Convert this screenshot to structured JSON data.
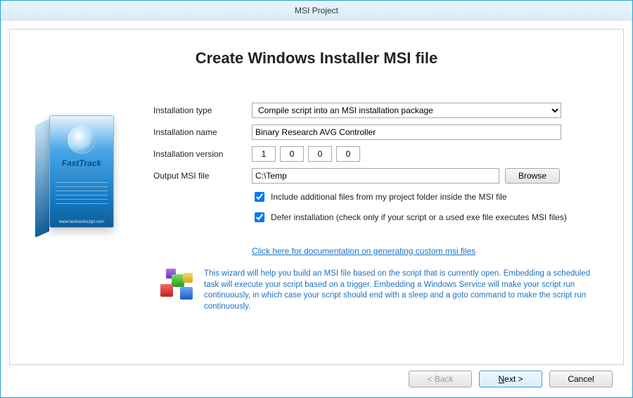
{
  "window": {
    "title": "MSI Project"
  },
  "page": {
    "heading": "Create Windows Installer MSI file"
  },
  "box": {
    "brand": "FastTrack",
    "tag": "ENTERPRISE",
    "footer": "www.fasttrackscript.com"
  },
  "labels": {
    "install_type": "Installation type",
    "install_name": "Installation name",
    "install_version": "Installation version",
    "output_file": "Output MSI file"
  },
  "fields": {
    "install_type_value": "Compile script into an MSI installation package",
    "install_name_value": "Binary Research AVG Controller",
    "version": [
      "1",
      "0",
      "0",
      "0"
    ],
    "output_path": "C:\\Temp",
    "browse_label": "Browse",
    "include_files_checked": true,
    "include_files_label": "Include additional files from my project folder inside the MSI file",
    "defer_checked": true,
    "defer_label": "Defer installation (check only if your script or a used exe file executes MSI files)"
  },
  "doc_link": "Click here for documentation on generating custom msi files",
  "help_text": "This wizard will help you build an MSI file based on the script that is currently open. Embedding a scheduled task will execute your script based on a trigger. Embedding a Windows Service will make your script run continuously, in which case your script should end with a sleep and a goto command to make the script run continuously.",
  "buttons": {
    "back": "< Back",
    "next_prefix": "N",
    "next_rest": "ext >",
    "cancel": "Cancel"
  }
}
